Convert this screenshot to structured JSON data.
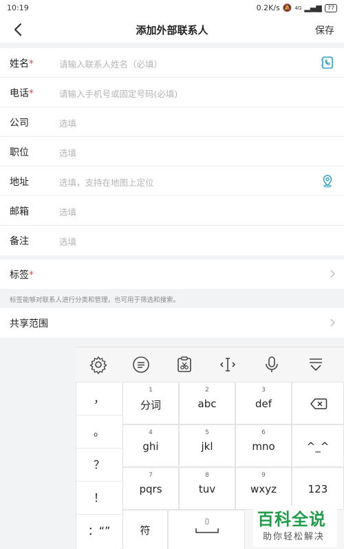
{
  "status_bar": {
    "time": "10:19",
    "speed": "0.2K/s",
    "signal": "4G",
    "battery": "77"
  },
  "header": {
    "title": "添加外部联系人",
    "save_label": "保存"
  },
  "form": {
    "fields": [
      {
        "label": "姓名",
        "required": true,
        "placeholder": "请输入联系人姓名（必填）",
        "icon": "contact-book-icon"
      },
      {
        "label": "电话",
        "required": true,
        "placeholder": "请输入手机号或固定号码(必填)"
      },
      {
        "label": "公司",
        "required": false,
        "placeholder": "选填"
      },
      {
        "label": "职位",
        "required": false,
        "placeholder": "选填"
      },
      {
        "label": "地址",
        "required": false,
        "placeholder": "选填，支持在地图上定位",
        "icon": "location-pin-icon"
      },
      {
        "label": "邮箱",
        "required": false,
        "placeholder": "选填"
      },
      {
        "label": "备注",
        "required": false,
        "placeholder": "选填"
      }
    ],
    "required_mark": "*"
  },
  "tags": {
    "label": "标签",
    "required_mark": "*",
    "hint": "标签能够对联系人进行分类和管理，也可用于筛选和搜索。"
  },
  "share": {
    "label": "共享范围"
  },
  "keyboard": {
    "toolbar": [
      "settings-icon",
      "emoji-chat-icon",
      "clipboard-icon",
      "cursor-move-icon",
      "microphone-icon",
      "collapse-keyboard-icon"
    ],
    "symbols": [
      "，",
      "。",
      "？",
      "！",
      "：“”"
    ],
    "keys": [
      {
        "num": "1",
        "label": "分词"
      },
      {
        "num": "2",
        "label": "abc"
      },
      {
        "num": "3",
        "label": "def"
      },
      {
        "num": "4",
        "label": "ghi"
      },
      {
        "num": "5",
        "label": "jkl"
      },
      {
        "num": "6",
        "label": "mno"
      },
      {
        "num": "7",
        "label": "pqrs"
      },
      {
        "num": "8",
        "label": "tuv"
      },
      {
        "num": "9",
        "label": "wxyz"
      }
    ],
    "backspace_icon": "backspace-icon",
    "emoticon_label": "^_^",
    "num_label": "123",
    "symbol_label": "符"
  },
  "watermark": {
    "title": "百科全说",
    "subtitle": "助你轻松解决"
  },
  "colors": {
    "accent": "#2aa3c9",
    "required": "#e54d4d",
    "watermark": "#1f9e4a"
  }
}
